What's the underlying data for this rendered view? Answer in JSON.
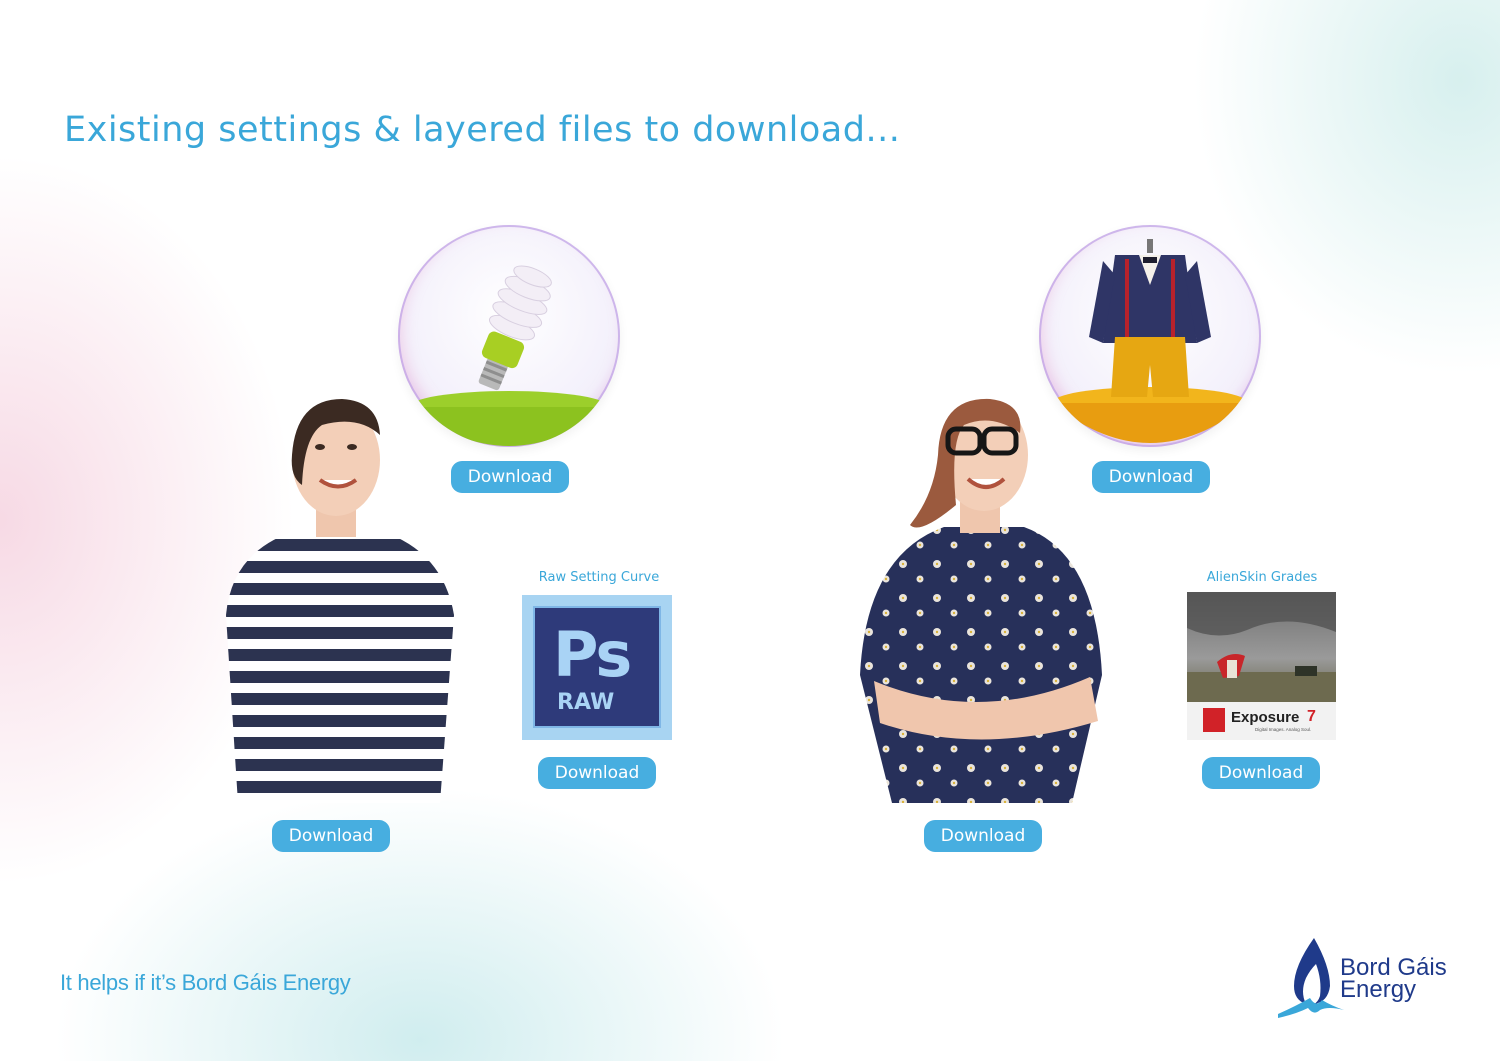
{
  "header": {
    "title": "Existing settings & layered files to download..."
  },
  "left_group": {
    "bubble_button": "Download",
    "person_button": "Download",
    "thumb_caption": "Raw Setting Curve",
    "thumb_badge_big": "Ps",
    "thumb_badge_small": "RAW",
    "thumb_button": "Download"
  },
  "right_group": {
    "bubble_button": "Download",
    "person_button": "Download",
    "thumb_caption": "AlienSkin Grades",
    "thumb_brand": "Exposure",
    "thumb_version": "7",
    "thumb_tagline": "Digital Images. Analog Soul.",
    "thumb_button": "Download"
  },
  "footer": {
    "tagline": "It helps if it’s Bord Gáis Energy",
    "logo_line1": "Bord Gáis",
    "logo_line2": "Energy"
  },
  "colors": {
    "accent": "#3aa7d9",
    "button": "#47aee0",
    "logo_navy": "#1f3a8a",
    "ps_dark": "#2e3a7a"
  }
}
